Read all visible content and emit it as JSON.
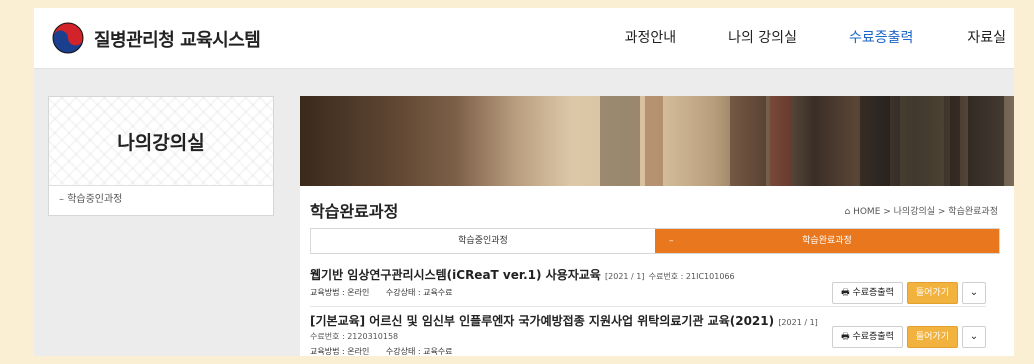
{
  "header": {
    "brand": "질병관리청 교육시스템",
    "nav": [
      {
        "label": "과정안내",
        "active": false
      },
      {
        "label": "나의 강의실",
        "active": false
      },
      {
        "label": "수료증출력",
        "active": true
      },
      {
        "label": "자료실",
        "active": false
      }
    ]
  },
  "sidebar": {
    "title": "나의강의실",
    "item": "학습중인과정",
    "item_prefix": "–"
  },
  "main": {
    "title": "학습완료과정",
    "breadcrumb": "HOME > 나의강의실 > 학습완료과정",
    "tabs": [
      {
        "label": "학습중인과정",
        "active": false
      },
      {
        "label": "학습완료과정",
        "active": true
      }
    ],
    "tab_active_prefix": "–",
    "courses": [
      {
        "title": "웹기반 임상연구관리시스템(iCReaT ver.1) 사용자교육",
        "meta": "[2021 / 1]",
        "cert": "수료번호 : 21IC101066",
        "method": "교육방법 : 온라인",
        "status": "수강상태 : 교육수료"
      },
      {
        "title": "[기본교육] 어르신 및 임신부 인플루엔자 국가예방접종 지원사업 위탁의료기관 교육(2021)",
        "meta": "[2021 / 1]",
        "cert": "수료번호 : 2120310158",
        "method": "교육방법 : 온라인",
        "status": "수강상태 : 교육수료"
      }
    ],
    "buttons": {
      "certificate": "수료증출력",
      "enter": "들어가기",
      "toggle": "⌄"
    }
  },
  "colors": {
    "accent": "#e8771d",
    "enter_button": "#f2b23e",
    "active_nav": "#1e66c8",
    "outer_background": "#fbefd3"
  }
}
